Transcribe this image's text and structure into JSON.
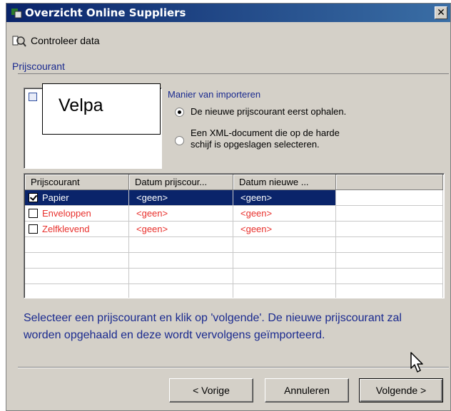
{
  "window": {
    "title": "Overzicht Online Suppliers",
    "close_glyph": "✕"
  },
  "toolbar": {
    "check_label": "Controleer data",
    "icon": "check-data-icon"
  },
  "group": {
    "label": "Prijscourant"
  },
  "overlay": {
    "supplier": "Velpa"
  },
  "import": {
    "label": "Manier van importeren",
    "options": [
      {
        "lines": [
          "De nieuwe prijscourant eerst ophalen."
        ],
        "checked": true
      },
      {
        "lines": [
          "Een XML-document die op de harde",
          "schijf is opgeslagen selecteren."
        ],
        "checked": false
      }
    ]
  },
  "grid": {
    "columns": [
      "Prijscourant",
      "Datum prijscour...",
      "Datum nieuwe ...",
      ""
    ],
    "rows": [
      {
        "name": "Papier",
        "date_current": "<geen>",
        "date_new": "<geen>",
        "checked": true,
        "selected": true,
        "status_color": "#ffffff"
      },
      {
        "name": "Enveloppen",
        "date_current": "<geen>",
        "date_new": "<geen>",
        "checked": false,
        "selected": false,
        "status_color": "#e8302c"
      },
      {
        "name": "Zelfklevend",
        "date_current": "<geen>",
        "date_new": "<geen>",
        "checked": false,
        "selected": false,
        "status_color": "#e8302c"
      }
    ]
  },
  "help": {
    "text": "Selecteer een prijscourant en klik op 'volgende'. De nieuwe prijscourant zal worden opgehaald en deze wordt vervolgens geïmporteerd."
  },
  "buttons": {
    "prev": "< Vorige",
    "cancel": "Annuleren",
    "next": "Volgende >"
  },
  "colors": {
    "title_bar": "#0a246a",
    "accent_blue": "#1a2a8f",
    "error_red": "#e8302c",
    "selection": "#0a246a"
  }
}
